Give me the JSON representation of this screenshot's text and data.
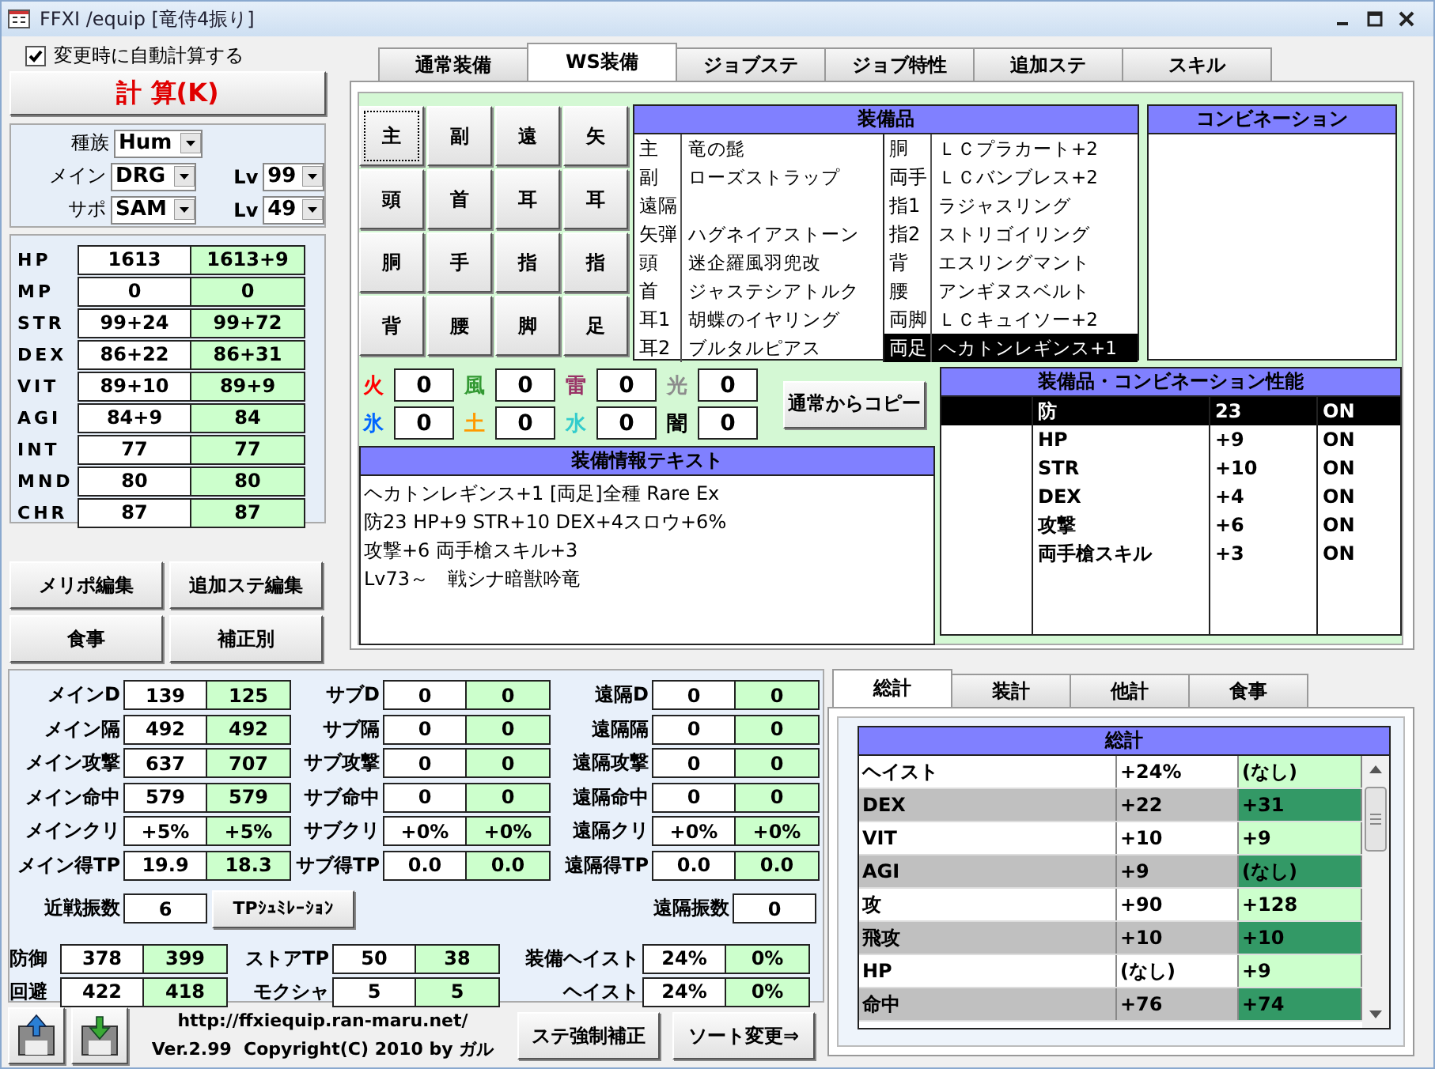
{
  "window": {
    "title": "FFXI /equip [竜侍4振り]"
  },
  "auto_calc": {
    "label": "変更時に自動計算する",
    "checked": true
  },
  "calc_button": "計 算(K)",
  "character": [
    {
      "label": "種族",
      "value": "Hum"
    },
    {
      "label": "メイン",
      "value": "DRG",
      "lv_label": "Lv",
      "lv": "99"
    },
    {
      "label": "サポ",
      "value": "SAM",
      "lv_label": "Lv",
      "lv": "49"
    }
  ],
  "stats": [
    {
      "label": "HP",
      "base": "1613",
      "total": "1613+9"
    },
    {
      "label": "MP",
      "base": "0",
      "total": "0"
    },
    {
      "label": "STR",
      "base": "99+24",
      "total": "99+72"
    },
    {
      "label": "DEX",
      "base": "86+22",
      "total": "86+31"
    },
    {
      "label": "VIT",
      "base": "89+10",
      "total": "89+9"
    },
    {
      "label": "AGI",
      "base": "84+9",
      "total": "84"
    },
    {
      "label": "INT",
      "base": "77",
      "total": "77"
    },
    {
      "label": "MND",
      "base": "80",
      "total": "80"
    },
    {
      "label": "CHR",
      "base": "87",
      "total": "87"
    }
  ],
  "left_buttons": [
    "メリポ編集",
    "追加ステ編集",
    "食事",
    "補正別"
  ],
  "tabs": [
    {
      "label": "通常装備",
      "selected": false
    },
    {
      "label": "WS装備",
      "selected": true
    },
    {
      "label": "ジョブステ",
      "selected": false
    },
    {
      "label": "ジョブ特性",
      "selected": false
    },
    {
      "label": "追加ステ",
      "selected": false
    },
    {
      "label": "スキル",
      "selected": false
    }
  ],
  "slot_buttons": [
    "主",
    "副",
    "遠",
    "矢",
    "頭",
    "首",
    "耳",
    "耳",
    "胴",
    "手",
    "指",
    "指",
    "背",
    "腰",
    "脚",
    "足"
  ],
  "equipment": {
    "title": "装備品",
    "left": [
      {
        "slot": "主",
        "item": "竜の髭",
        "selected": false
      },
      {
        "slot": "副",
        "item": "ローズストラップ",
        "selected": false
      },
      {
        "slot": "遠隔",
        "selected": false
      },
      {
        "slot": "矢弾",
        "item": "ハグネイアストーン",
        "selected": false
      },
      {
        "slot": "頭",
        "item": "迷企羅風羽兜改",
        "selected": false
      },
      {
        "slot": "首",
        "item": "ジャステシアトルク",
        "selected": false
      },
      {
        "slot": "耳1",
        "item": "胡蝶のイヤリング",
        "selected": false
      },
      {
        "slot": "耳2",
        "item": "ブルタルピアス",
        "selected": false
      }
    ],
    "right": [
      {
        "slot": "胴",
        "item": "ＬＣプラカート+2",
        "selected": false
      },
      {
        "slot": "両手",
        "item": "ＬＣバンブレス+2",
        "selected": false
      },
      {
        "slot": "指1",
        "item": "ラジャスリング",
        "selected": false
      },
      {
        "slot": "指2",
        "item": "ストリゴイリング",
        "selected": false
      },
      {
        "slot": "背",
        "item": "エスリングマント",
        "selected": false
      },
      {
        "slot": "腰",
        "item": "アンギヌスベルト",
        "selected": false
      },
      {
        "slot": "両脚",
        "item": "ＬＣキュイソー+2",
        "selected": false
      },
      {
        "slot": "両足",
        "item": "ヘカトンレギンス+1",
        "selected": true
      }
    ]
  },
  "combination": {
    "title": "コンビネーション"
  },
  "elements": [
    {
      "label": "火",
      "value": "0",
      "color": "#ff0000"
    },
    {
      "label": "風",
      "value": "0",
      "color": "#339933"
    },
    {
      "label": "雷",
      "value": "0",
      "color": "#993366"
    },
    {
      "label": "光",
      "value": "0",
      "color": "#8c8c8c"
    },
    {
      "label": "氷",
      "value": "0",
      "color": "#0066ff"
    },
    {
      "label": "土",
      "value": "0",
      "color": "#ff9900"
    },
    {
      "label": "水",
      "value": "0",
      "color": "#33cccc"
    },
    {
      "label": "闇",
      "value": "0",
      "color": "#000000"
    }
  ],
  "copy_button": "通常からコピー",
  "info": {
    "title": "装備情報テキスト",
    "lines": [
      "ヘカトンレギンス+1 [両足]全種 Rare Ex",
      "防23 HP+9 STR+10 DEX+4スロウ+6%",
      "攻撃+6 両手槍スキル+3",
      "Lv73～　戦シナ暗獣吟竜"
    ]
  },
  "performance": {
    "title": "装備品・コンビネーション性能",
    "rows": [
      {
        "name": "防",
        "value": "23",
        "status": "ON",
        "selected": true
      },
      {
        "name": "HP",
        "value": "+9",
        "status": "ON",
        "selected": false
      },
      {
        "name": "STR",
        "value": "+10",
        "status": "ON",
        "selected": false
      },
      {
        "name": "DEX",
        "value": "+4",
        "status": "ON",
        "selected": false
      },
      {
        "name": "攻撃",
        "value": "+6",
        "status": "ON",
        "selected": false
      },
      {
        "name": "両手槍スキル",
        "value": "+3",
        "status": "ON",
        "selected": false
      }
    ]
  },
  "combat": [
    [
      {
        "label": "メインD",
        "base": "139",
        "total": "125"
      },
      {
        "label": "メイン隔",
        "base": "492",
        "total": "492"
      },
      {
        "label": "メイン攻撃",
        "base": "637",
        "total": "707"
      },
      {
        "label": "メイン命中",
        "base": "579",
        "total": "579"
      },
      {
        "label": "メインクリ",
        "base": "+5%",
        "total": "+5%"
      },
      {
        "label": "メイン得TP",
        "base": "19.9",
        "total": "18.3"
      }
    ],
    [
      {
        "label": "サブD",
        "base": "0",
        "total": "0"
      },
      {
        "label": "サブ隔",
        "base": "0",
        "total": "0"
      },
      {
        "label": "サブ攻撃",
        "base": "0",
        "total": "0"
      },
      {
        "label": "サブ命中",
        "base": "0",
        "total": "0"
      },
      {
        "label": "サブクリ",
        "base": "+0%",
        "total": "+0%"
      },
      {
        "label": "サブ得TP",
        "base": "0.0",
        "total": "0.0"
      }
    ],
    [
      {
        "label": "遠隔D",
        "base": "0",
        "total": "0"
      },
      {
        "label": "遠隔隔",
        "base": "0",
        "total": "0"
      },
      {
        "label": "遠隔攻撃",
        "base": "0",
        "total": "0"
      },
      {
        "label": "遠隔命中",
        "base": "0",
        "total": "0"
      },
      {
        "label": "遠隔クリ",
        "base": "+0%",
        "total": "+0%"
      },
      {
        "label": "遠隔得TP",
        "base": "0.0",
        "total": "0.0"
      }
    ]
  ],
  "swings": [
    {
      "label": "近戦振数",
      "value": "6"
    },
    {
      "label": "遠隔振数",
      "value": "0"
    }
  ],
  "tp_sim_button": "TPｼｭﾐﾚｰｼｮﾝ",
  "extra": [
    [
      {
        "label": "防御",
        "base": "378",
        "total": "399"
      },
      {
        "label": "回避",
        "base": "422",
        "total": "418"
      }
    ],
    [
      {
        "label": "ストアTP",
        "base": "50",
        "total": "38"
      },
      {
        "label": "モクシャ",
        "base": "5",
        "total": "5"
      }
    ],
    [
      {
        "label": "装備ヘイスト",
        "base": "24%",
        "total": "0%"
      },
      {
        "label": "ヘイスト",
        "base": "24%",
        "total": "0%"
      }
    ]
  ],
  "footer": {
    "url": "http://ffxiequip.ran-maru.net/",
    "version": "Ver.2.99  Copyright(C) 2010 by ガル",
    "buttons": [
      "ステ強制補正",
      "ソート変更⇒"
    ]
  },
  "summary": {
    "tabs": [
      {
        "label": "総計",
        "selected": true
      },
      {
        "label": "装計",
        "selected": false
      },
      {
        "label": "他計",
        "selected": false
      },
      {
        "label": "食事",
        "selected": false
      }
    ],
    "title": "総計",
    "rows": [
      {
        "name": "ヘイスト",
        "equip": "+24%",
        "total": "(なし)"
      },
      {
        "name": "DEX",
        "equip": "+22",
        "total": "+31"
      },
      {
        "name": "VIT",
        "equip": "+10",
        "total": "+9"
      },
      {
        "name": "AGI",
        "equip": "+9",
        "total": "(なし)"
      },
      {
        "name": "攻",
        "equip": "+90",
        "total": "+128"
      },
      {
        "name": "飛攻",
        "equip": "+10",
        "total": "+10"
      },
      {
        "name": "HP",
        "equip": "(なし)",
        "total": "+9"
      },
      {
        "name": "命中",
        "equip": "+76",
        "total": "+74"
      }
    ]
  }
}
